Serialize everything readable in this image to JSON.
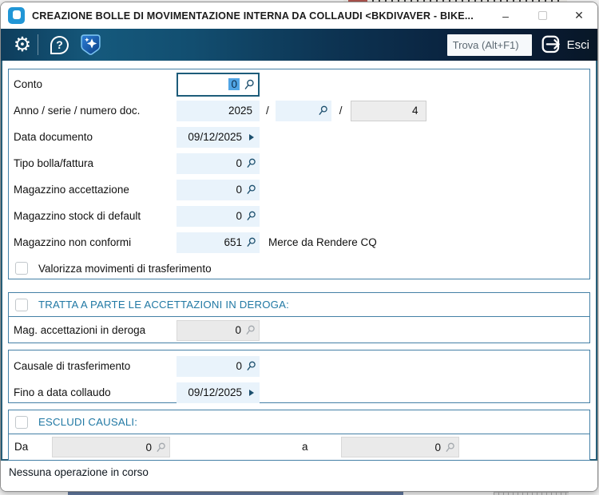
{
  "window": {
    "title": "CREAZIONE BOLLE DI MOVIMENTAZIONE INTERNA DA COLLAUDI <BKDIVAVER - BIKE...",
    "minimize_glyph": "–",
    "close_glyph": "✕"
  },
  "toolbar": {
    "gear_glyph": "⚙",
    "help_glyph": "?",
    "find_placeholder": "Trova (Alt+F1)",
    "exit_label": "Esci"
  },
  "form": {
    "s1": {
      "rows": [
        {
          "label": "Conto",
          "value": "0"
        },
        {
          "label": "Anno / serie / numero doc.",
          "year": "2025",
          "sep1": "/",
          "serie": "",
          "sep2": "/",
          "numero": "4"
        },
        {
          "label": "Data documento",
          "value": "09/12/2025"
        },
        {
          "label": "Tipo bolla/fattura",
          "value": "0"
        },
        {
          "label": "Magazzino accettazione",
          "value": "0"
        },
        {
          "label": "Magazzino stock di default",
          "value": "0"
        },
        {
          "label": "Magazzino non conformi",
          "value": "651",
          "description": "Merce da Rendere CQ"
        }
      ],
      "checkbox_label": "Valorizza movimenti di trasferimento"
    },
    "s2": {
      "header": "TRATTA A PARTE LE ACCETTAZIONI IN DEROGA:",
      "row": {
        "label": "Mag. accettazioni in deroga",
        "value": "0"
      }
    },
    "s3": {
      "rows": [
        {
          "label": "Causale di trasferimento",
          "value": "0"
        },
        {
          "label": "Fino a data collaudo",
          "value": "09/12/2025"
        }
      ]
    },
    "s4": {
      "header": "ESCLUDI CAUSALI:",
      "from_label": "Da",
      "from_value": "0",
      "to_label": "a",
      "to_value": "0"
    }
  },
  "status": {
    "text": "Nessuna operazione in corso"
  },
  "colors": {
    "accent_teal": "#2279a4",
    "toolbar_dark": "#0a2440",
    "toolbar_light": "#15597c",
    "field_blue": "#e9f3fb",
    "selection_blue": "#51a5e5",
    "section_border": "#4480a6",
    "app_icon_blue": "#2196d6"
  }
}
